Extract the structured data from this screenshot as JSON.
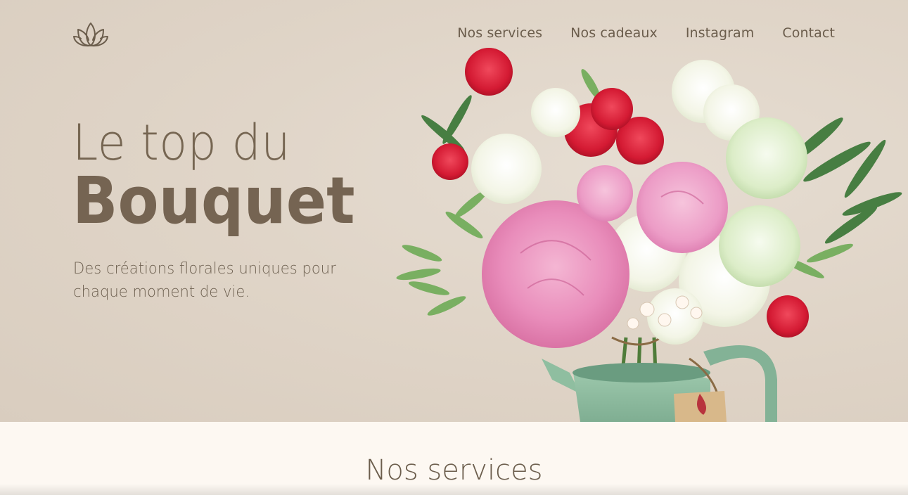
{
  "nav": {
    "logo_icon": "lotus-icon",
    "items": [
      {
        "label": "Nos services"
      },
      {
        "label": "Nos cadeaux"
      },
      {
        "label": "Instagram"
      },
      {
        "label": "Contact"
      }
    ]
  },
  "hero": {
    "title_light": "Le top du",
    "title_bold": "Bouquet",
    "subtitle": "Des créations florales uniques pour chaque moment de vie.",
    "image_icon": "flower-bouquet-image"
  },
  "services": {
    "title": "Nos services"
  },
  "colors": {
    "text_brown": "#756452",
    "hero_background": "#e0d5c8",
    "section_background": "#fdf8f2"
  }
}
